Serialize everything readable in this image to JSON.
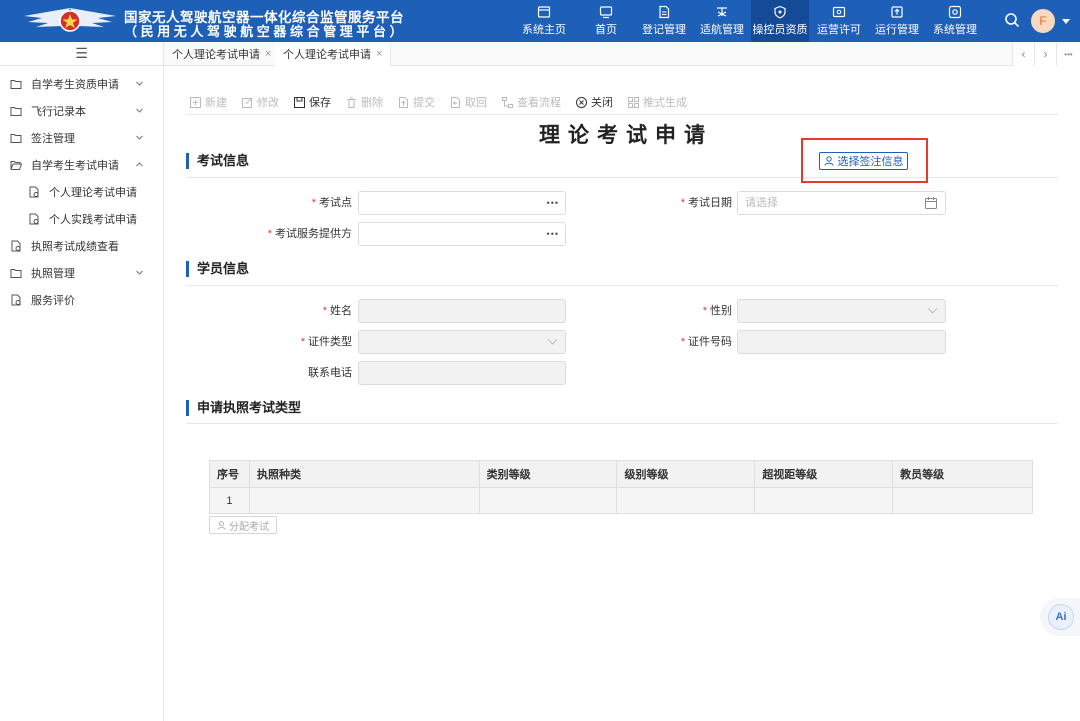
{
  "header": {
    "title_line1": "国家无人驾驶航空器一体化综合监管服务平台",
    "title_line2": "（民用无人驾驶航空器综合管理平台）",
    "nav": [
      {
        "label": "系统主页",
        "icon": "window-icon"
      },
      {
        "label": "首页",
        "icon": "monitor-icon"
      },
      {
        "label": "登记管理",
        "icon": "document-icon"
      },
      {
        "label": "适航管理",
        "icon": "drone-icon"
      },
      {
        "label": "操控员资质",
        "icon": "shield-icon",
        "active": true
      },
      {
        "label": "运营许可",
        "icon": "certificate-icon"
      },
      {
        "label": "运行管理",
        "icon": "upload-icon"
      },
      {
        "label": "系统管理",
        "icon": "settings-icon"
      }
    ],
    "avatar_letter": "F",
    "accent_color": "#1e5fb8"
  },
  "sidebar": {
    "toggle": "☰",
    "items": [
      {
        "label": "自学考生资质申请",
        "expandable": true
      },
      {
        "label": "飞行记录本",
        "expandable": true
      },
      {
        "label": "签注管理",
        "expandable": true
      },
      {
        "label": "自学考生考试申请",
        "expandable": true,
        "expanded": true
      },
      {
        "label": "个人理论考试申请",
        "child": true
      },
      {
        "label": "个人实践考试申请",
        "child": true
      },
      {
        "label": "执照考试成绩查看"
      },
      {
        "label": "执照管理",
        "expandable": true
      },
      {
        "label": "服务评价"
      }
    ]
  },
  "tabs": [
    {
      "label": "个人理论考试申请",
      "close": "×"
    },
    {
      "label": "个人理论考试申请",
      "close": "×",
      "active": true
    }
  ],
  "tab_controls": {
    "prev": "‹",
    "next": "›",
    "more": "•••"
  },
  "toolbar": [
    {
      "label": "新建",
      "icon": "plus-icon",
      "enabled": false
    },
    {
      "label": "修改",
      "icon": "edit-icon",
      "enabled": false
    },
    {
      "label": "保存",
      "icon": "save-icon",
      "enabled": true
    },
    {
      "label": "删除",
      "icon": "trash-icon",
      "enabled": false
    },
    {
      "label": "提交",
      "icon": "submit-icon",
      "enabled": false
    },
    {
      "label": "取回",
      "icon": "retrieve-icon",
      "enabled": false
    },
    {
      "label": "查看流程",
      "icon": "flow-icon",
      "enabled": false
    },
    {
      "label": "关闭",
      "icon": "close-circle-icon",
      "enabled": true
    },
    {
      "label": "推式生成",
      "icon": "grid-icon",
      "enabled": false
    }
  ],
  "page_title": "理论考试申请",
  "exam_section": {
    "title": "考试信息",
    "select_button": "选择签注信息",
    "fields": {
      "exam_site": {
        "label": "考试点",
        "required": true,
        "value": ""
      },
      "exam_date": {
        "label": "考试日期",
        "required": true,
        "placeholder": "请选择"
      },
      "provider": {
        "label": "考试服务提供方",
        "required": true,
        "value": ""
      }
    }
  },
  "student_section": {
    "title": "学员信息",
    "fields": {
      "name": {
        "label": "姓名",
        "required": true
      },
      "gender": {
        "label": "性别",
        "required": true
      },
      "id_type": {
        "label": "证件类型",
        "required": true
      },
      "id_number": {
        "label": "证件号码",
        "required": true
      },
      "phone": {
        "label": "联系电话",
        "required": false
      }
    }
  },
  "license_section": {
    "title": "申请执照考试类型",
    "columns": [
      "序号",
      "执照种类",
      "类别等级",
      "级别等级",
      "超视距等级",
      "教员等级"
    ],
    "rows": [
      [
        "1",
        "",
        "",
        "",
        "",
        ""
      ]
    ],
    "assign_button": "分配考试"
  },
  "ai_badge": "Ai"
}
